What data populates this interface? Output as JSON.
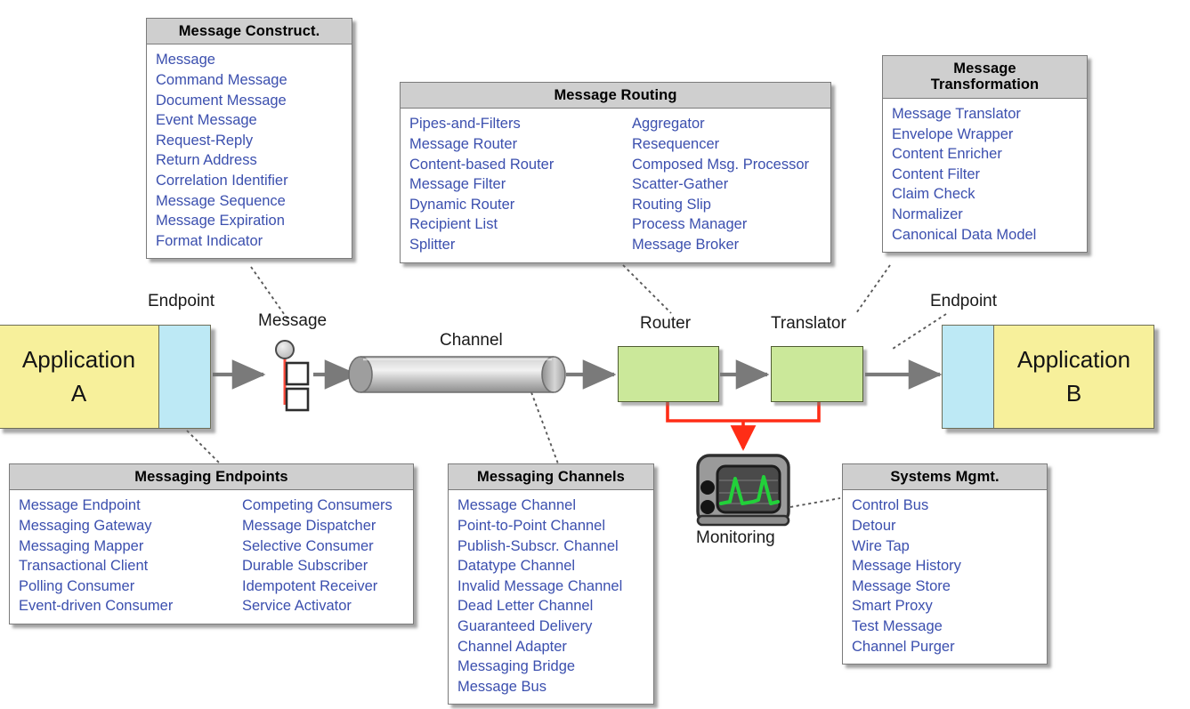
{
  "diagram": {
    "title": "Enterprise Integration Patterns overview",
    "colors": {
      "panel_header": "#cfcfcf",
      "panel_border": "#7b7b7b",
      "item_text": "#3b4fae",
      "application_fill": "#f7f09b",
      "endpoint_fill": "#bde9f5",
      "component_fill": "#cbe89a",
      "control_bus": "#ff2d16",
      "monitor_trace": "#22d13a",
      "arrow": "#7a7a7a"
    }
  },
  "panels": {
    "message_construct": {
      "title": "Message Construct.",
      "columns": [
        [
          "Message",
          "Command Message",
          "Document Message",
          "Event Message",
          "Request-Reply",
          "Return Address",
          "Correlation Identifier",
          "Message Sequence",
          "Message Expiration",
          "Format Indicator"
        ]
      ]
    },
    "message_routing": {
      "title": "Message Routing",
      "columns": [
        [
          "Pipes-and-Filters",
          "Message Router",
          "Content-based Router",
          "Message Filter",
          "Dynamic Router",
          "Recipient List",
          "Splitter"
        ],
        [
          "Aggregator",
          "Resequencer",
          "Composed Msg. Processor",
          "Scatter-Gather",
          "Routing Slip",
          "Process Manager",
          "Message Broker"
        ]
      ]
    },
    "message_transformation": {
      "title": "Message\nTransformation",
      "title_line1": "Message",
      "title_line2": "Transformation",
      "columns": [
        [
          "Message Translator",
          "Envelope Wrapper",
          "Content Enricher",
          "Content Filter",
          "Claim Check",
          "Normalizer",
          "Canonical Data Model"
        ]
      ]
    },
    "messaging_endpoints": {
      "title": "Messaging Endpoints",
      "columns": [
        [
          "Message Endpoint",
          "Messaging Gateway",
          "Messaging Mapper",
          "Transactional Client",
          "Polling Consumer",
          "Event-driven Consumer"
        ],
        [
          "Competing Consumers",
          "Message Dispatcher",
          "Selective Consumer",
          "Durable Subscriber",
          "Idempotent Receiver",
          "Service Activator"
        ]
      ]
    },
    "messaging_channels": {
      "title": "Messaging Channels",
      "columns": [
        [
          "Message Channel",
          "Point-to-Point Channel",
          "Publish-Subscr. Channel",
          "Datatype Channel",
          "Invalid Message Channel",
          "Dead Letter Channel",
          "Guaranteed Delivery",
          "Channel Adapter",
          "Messaging Bridge",
          "Message Bus"
        ]
      ]
    },
    "systems_mgmt": {
      "title": "Systems Mgmt.",
      "columns": [
        [
          "Control Bus",
          "Detour",
          "Wire Tap",
          "Message History",
          "Message Store",
          "Smart Proxy",
          "Test Message",
          "Channel Purger"
        ]
      ]
    }
  },
  "flow": {
    "application_a": {
      "name_line1": "Application",
      "name_line2": "A"
    },
    "application_b": {
      "name_line1": "Application",
      "name_line2": "B"
    },
    "labels": {
      "endpoint_left": "Endpoint",
      "message": "Message",
      "channel": "Channel",
      "router": "Router",
      "translator": "Translator",
      "endpoint_right": "Endpoint",
      "monitoring": "Monitoring"
    }
  }
}
